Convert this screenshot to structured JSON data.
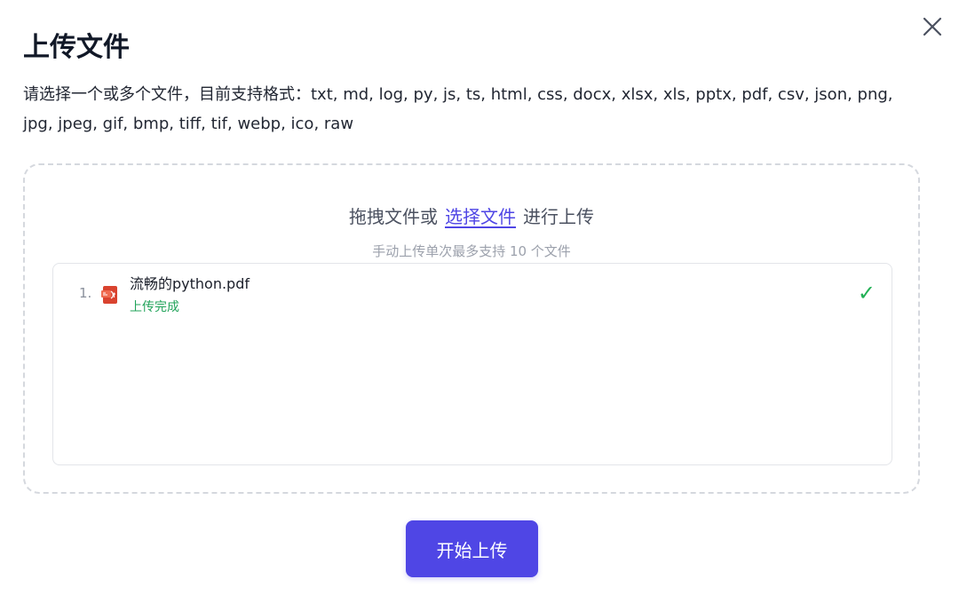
{
  "dialog": {
    "title": "上传文件",
    "description": "请选择一个或多个文件，目前支持格式：txt, md, log, py, js, ts, html, css, docx, xlsx, xls, pptx, pdf, csv, json, png, jpg, jpeg, gif, bmp, tiff, tif, webp, ico, raw",
    "close_icon": "close-icon"
  },
  "dropzone": {
    "hint_prefix": "拖拽文件或",
    "choose_link": "选择文件",
    "hint_suffix": "进行上传",
    "limit_hint": "手动上传单次最多支持 10 个文件"
  },
  "files": [
    {
      "index": "1.",
      "name": "流畅的python.pdf",
      "status": "上传完成",
      "icon": "pdf-file-icon",
      "status_icon": "check-icon",
      "check": "✓"
    }
  ],
  "actions": {
    "start_label": "开始上传"
  },
  "colors": {
    "accent": "#4f46e5",
    "success": "#22a35a",
    "pdf_red": "#d9432f"
  }
}
